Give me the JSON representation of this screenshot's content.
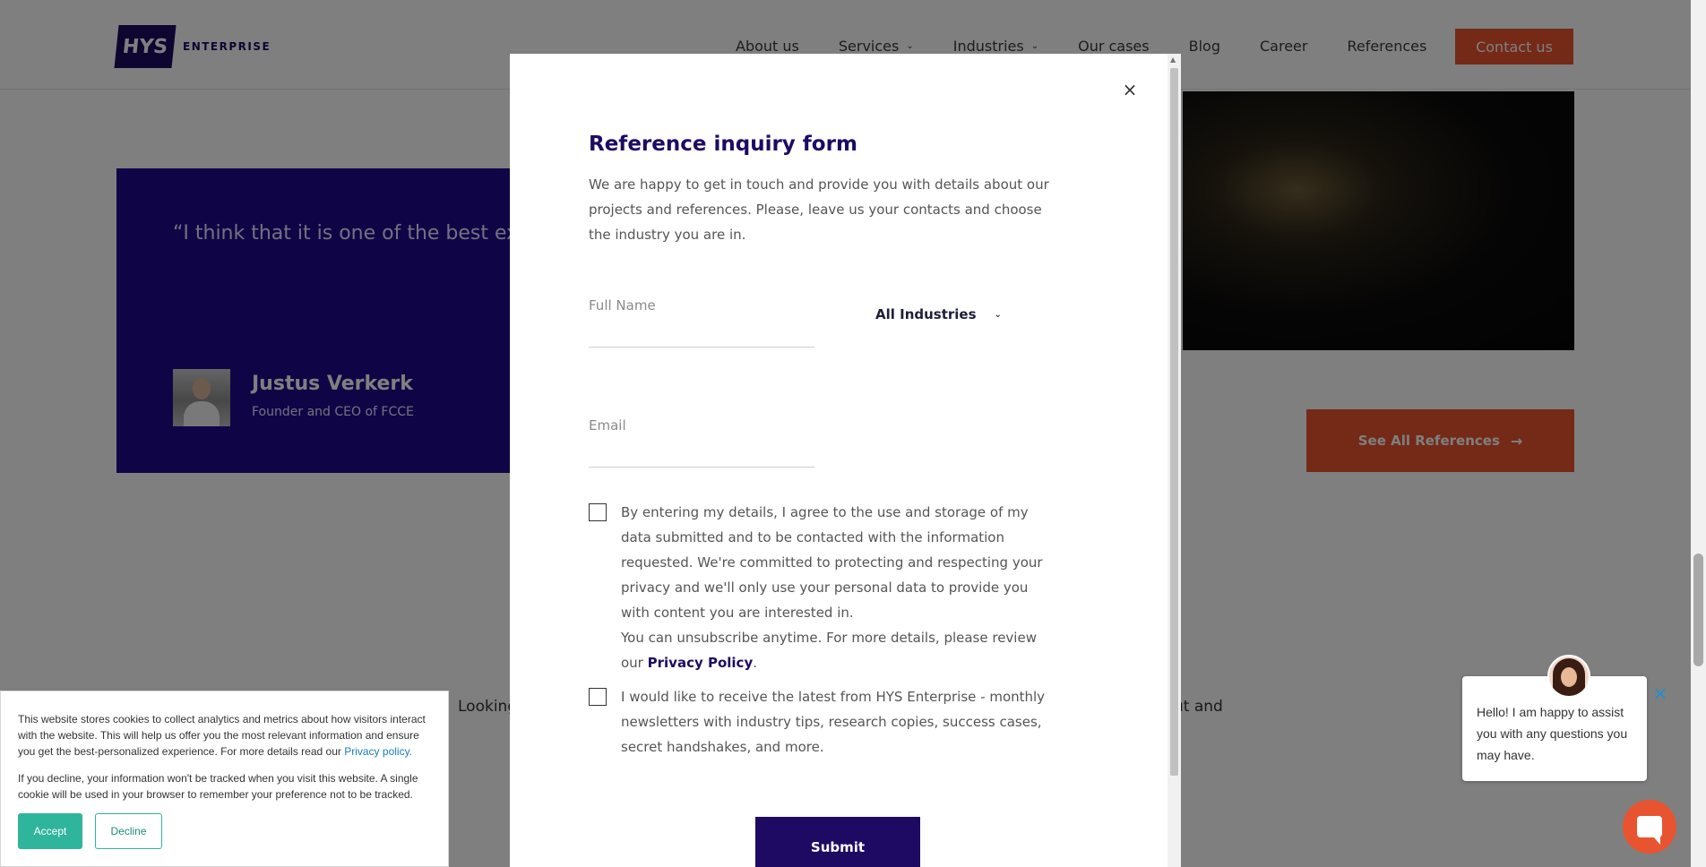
{
  "header": {
    "logo_mark": "HYS",
    "logo_text": "ENTERPRISE",
    "nav": [
      {
        "label": "About us"
      },
      {
        "label": "Services"
      },
      {
        "label": "Industries"
      },
      {
        "label": "Our cases"
      },
      {
        "label": "Blog"
      },
      {
        "label": "Career"
      },
      {
        "label": "References"
      }
    ],
    "contact_label": "Contact us"
  },
  "testimonial": {
    "quote": "“I think that it is one of the best ex with people who build things like t",
    "name": "Justus Verkerk",
    "role": "Founder and CEO of FCCE"
  },
  "see_all_label": "See All References",
  "bg_text": {
    "left": "Looking",
    "right": "ut and"
  },
  "modal": {
    "title": "Reference inquiry form",
    "description": "We are happy to get in touch and provide you with details about our projects and references. Please, leave us your contacts and choose the industry you are in.",
    "full_name_placeholder": "Full Name",
    "email_placeholder": "Email",
    "industry_value": "All Industries",
    "consent1_text": "By entering my details, I agree to the use and storage of my data submitted and to be contacted with the information requested. We're committed to protecting and respecting your privacy and we'll only use your personal data to provide you with content you are interested in.",
    "consent1_text2": "You can unsubscribe anytime. For more details, please review our",
    "privacy_link": "Privacy Policy",
    "consent2_text": "I would like to receive the latest from HYS Enterprise - monthly newsletters with industry tips, research copies, success cases, secret handshakes, and more.",
    "submit_label": "Submit",
    "close_label": "×"
  },
  "cookie": {
    "text1": "This website stores cookies to collect analytics and metrics about how visitors interact with the website. This will help us offer you the most relevant information and ensure you get the best-personalized experience. For more details read our",
    "privacy_link": "Privacy policy.",
    "text2": "If you decline, your information won't be tracked when you visit this website. A single cookie will be used in your browser to remember your preference not to be tracked.",
    "accept_label": "Accept",
    "decline_label": "Decline"
  },
  "chat": {
    "message": "Hello! I am happy to assist you with any questions you may have.",
    "close_label": "×"
  },
  "colors": {
    "brand_navy": "#1e0a63",
    "accent_orange": "#e8542f",
    "cookie_green": "#2fb59c"
  }
}
